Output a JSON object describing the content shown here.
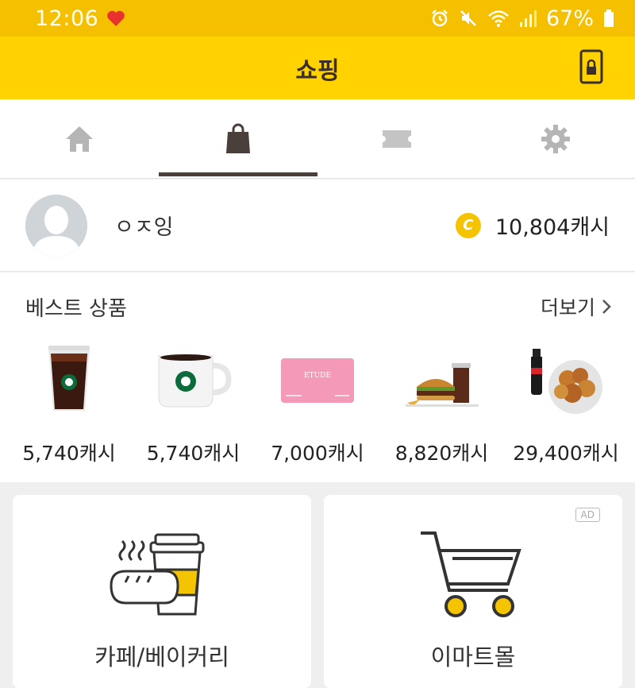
{
  "status_bar": {
    "time": "12:06",
    "battery": "67%"
  },
  "header": {
    "title": "쇼핑"
  },
  "tabs": [
    {
      "name": "home",
      "icon": "home-icon",
      "active": false
    },
    {
      "name": "shopping",
      "icon": "shopping-bag-icon",
      "active": true
    },
    {
      "name": "ticket",
      "icon": "ticket-icon",
      "active": false
    },
    {
      "name": "settings",
      "icon": "gear-icon",
      "active": false
    }
  ],
  "profile": {
    "username": "ㅇㅈ잉",
    "coin_symbol": "C",
    "cash": "10,804캐시"
  },
  "best": {
    "title": "베스트 상품",
    "more_label": "더보기",
    "products": [
      {
        "image": "iced-coffee",
        "price": "5,740캐시"
      },
      {
        "image": "hot-coffee-mug",
        "price": "5,740캐시"
      },
      {
        "image": "gift-card",
        "price": "7,000캐시"
      },
      {
        "image": "burger-set",
        "price": "8,820캐시"
      },
      {
        "image": "chicken-cola",
        "price": "29,400캐시"
      }
    ],
    "gift_card_brand": "ETUDE"
  },
  "cards": [
    {
      "label": "카페/베이커리",
      "icon": "cafe-bakery-icon"
    },
    {
      "label": "이마트몰",
      "icon": "shopping-cart-icon",
      "badge": "AD"
    }
  ],
  "colors": {
    "status_bar": "#f5c000",
    "header": "#ffd200",
    "accent": "#f5c400"
  }
}
